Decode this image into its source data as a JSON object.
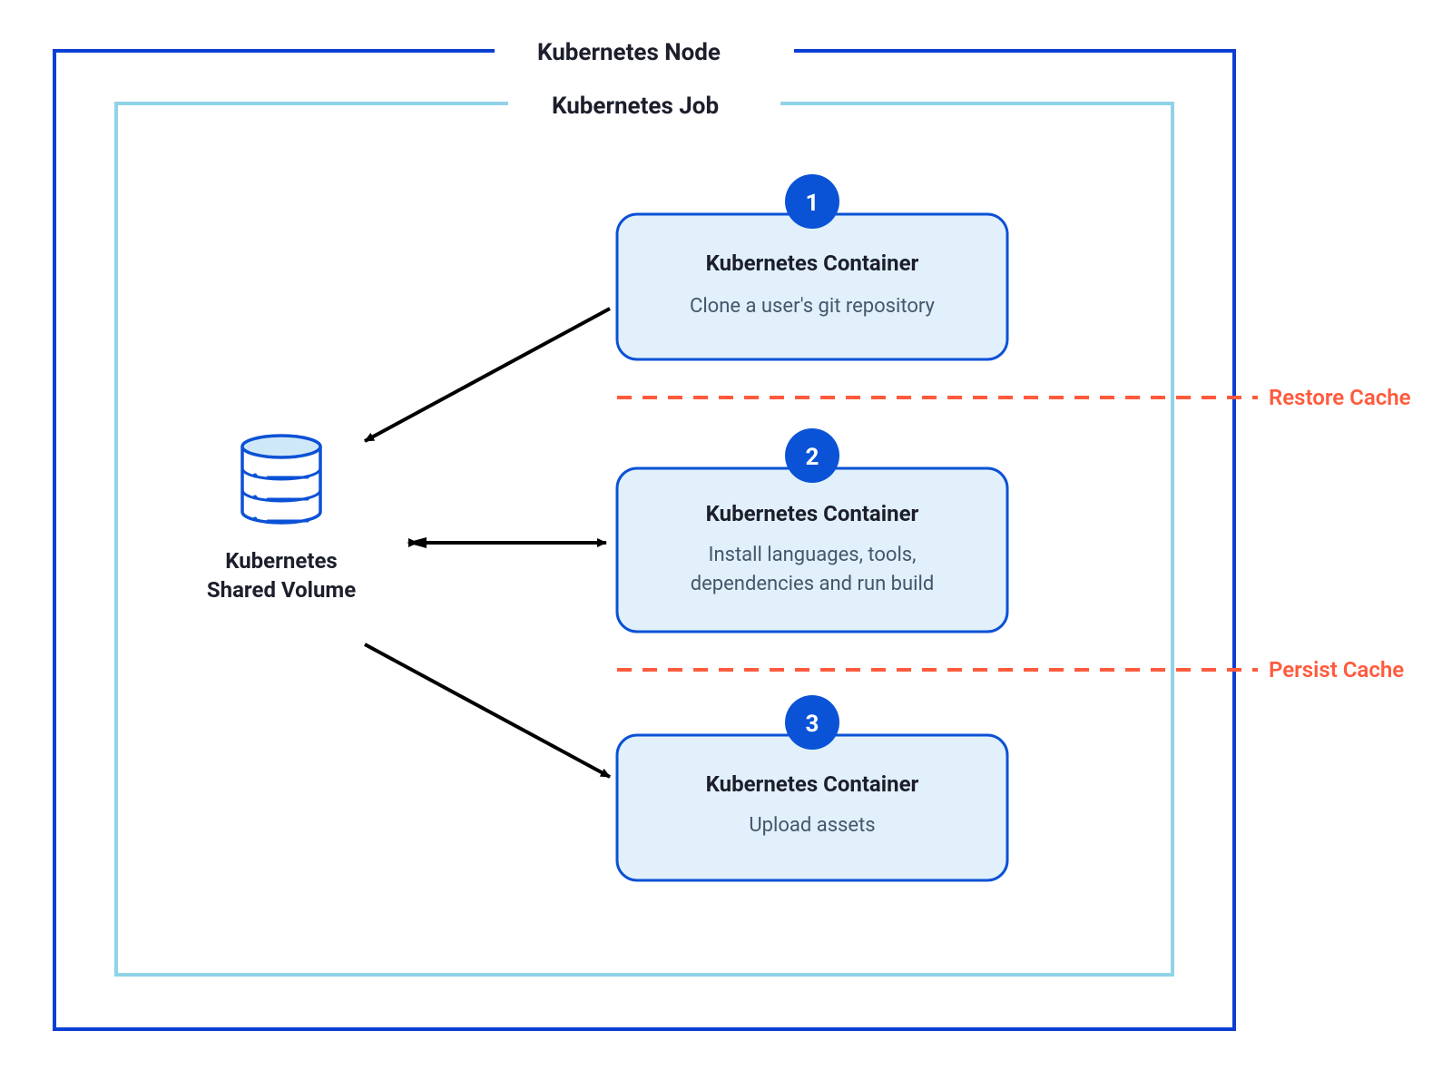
{
  "colors": {
    "node_border": "#0b3fd3",
    "job_border": "#8fd3e8",
    "card_border": "#0b51d6",
    "card_fill": "#e1f0fa",
    "badge_fill": "#0b53d6",
    "arrow": "#000000",
    "cache": "#ff5a3c",
    "text_dark": "#1c1f2b",
    "text_sub": "#45566b"
  },
  "outer_box": {
    "label": "Kubernetes Node"
  },
  "inner_box": {
    "label": "Kubernetes Job"
  },
  "shared_volume": {
    "line1": "Kubernetes",
    "line2": "Shared Volume"
  },
  "containers": [
    {
      "badge": "1",
      "title": "Kubernetes Container",
      "subtitle_lines": [
        "Clone a user's git repository"
      ]
    },
    {
      "badge": "2",
      "title": "Kubernetes Container",
      "subtitle_lines": [
        "Install languages, tools,",
        "dependencies and run build"
      ]
    },
    {
      "badge": "3",
      "title": "Kubernetes Container",
      "subtitle_lines": [
        "Upload assets"
      ]
    }
  ],
  "cache_dividers": [
    {
      "label": "Restore Cache"
    },
    {
      "label": "Persist Cache"
    }
  ]
}
